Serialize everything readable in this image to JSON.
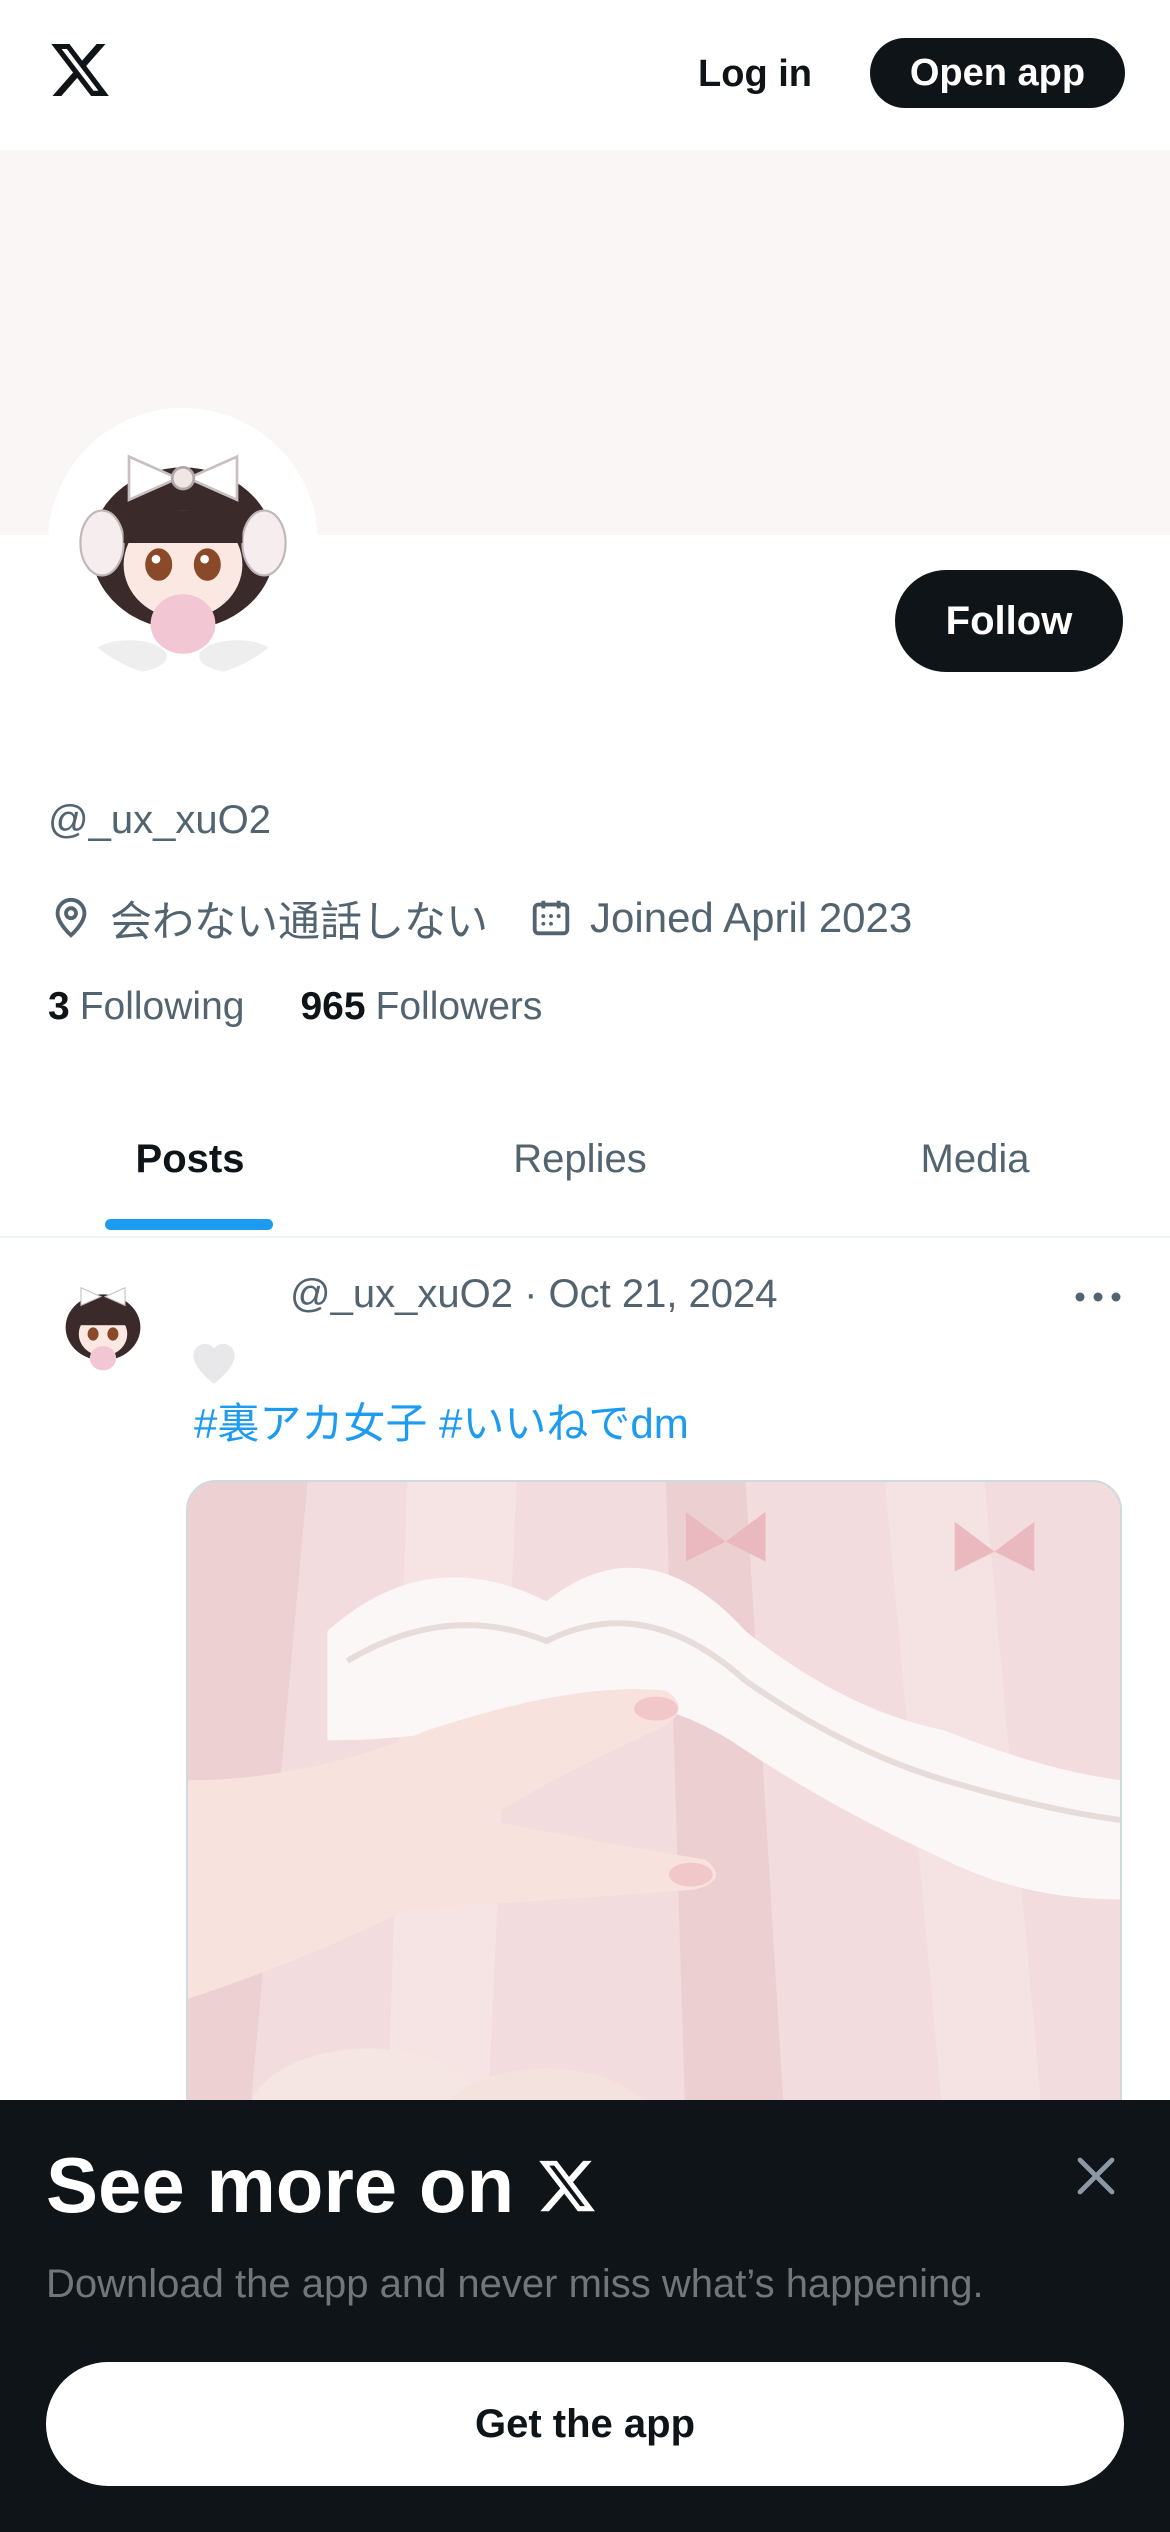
{
  "topbar": {
    "logo_icon": "x-logo-icon",
    "login_label": "Log in",
    "open_app_label": "Open app"
  },
  "profile": {
    "follow_label": "Follow",
    "handle": "@_ux_xuO2",
    "location": "会わない通話しない",
    "joined": "Joined April 2023",
    "following_count": "3",
    "following_label": "Following",
    "followers_count": "965",
    "followers_label": "Followers"
  },
  "tabs": [
    {
      "label": "Posts",
      "active": true
    },
    {
      "label": "Replies",
      "active": false
    },
    {
      "label": "Media",
      "active": false
    }
  ],
  "post": {
    "meta": "@_ux_xuO2 · Oct 21, 2024",
    "text": "#裏アカ女子 #いいねでdm"
  },
  "promo": {
    "title": "See more on",
    "subtitle": "Download the app and never miss what’s happening.",
    "button_label": "Get the app"
  },
  "colors": {
    "brand_dark": "#0f1419",
    "accent_blue": "#1d9bf0",
    "secondary_text": "#536471",
    "banner_bg": "#fbf6f6"
  }
}
